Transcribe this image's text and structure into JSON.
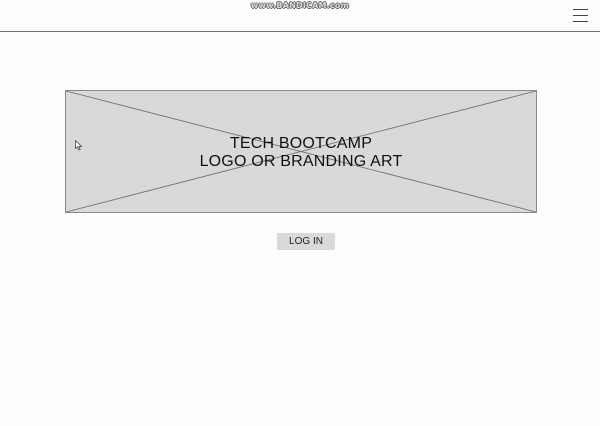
{
  "recorder": {
    "watermark": "www.BANDICAM.com"
  },
  "header": {
    "menu_icon": "hamburger-menu-icon"
  },
  "hero": {
    "line1": "TECH BOOTCAMP",
    "line2": "LOGO OR BRANDING ART"
  },
  "actions": {
    "login_label": "LOG IN"
  },
  "colors": {
    "background": "#fdfcfe",
    "placeholder_fill": "#d9d8da",
    "button_fill": "#d9d8da",
    "text": "#111111"
  }
}
